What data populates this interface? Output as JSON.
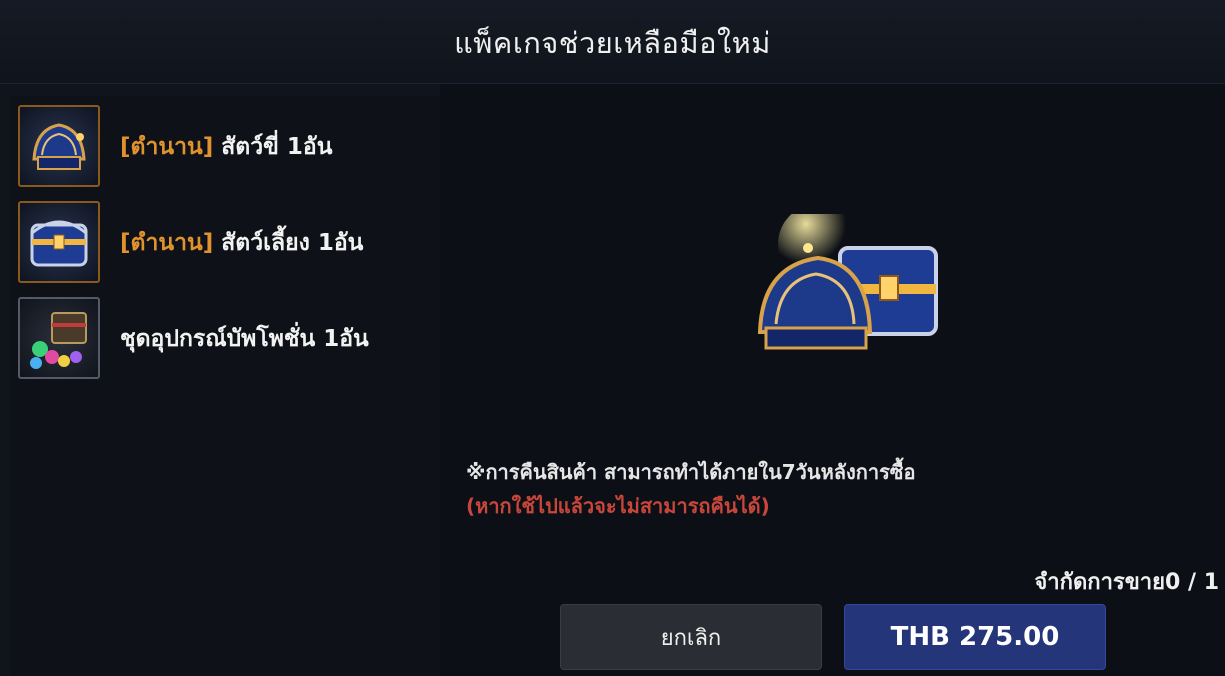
{
  "modal": {
    "title": "แพ็คเกจช่วยเหลือมือใหม่"
  },
  "items": [
    {
      "tag": "[ตำนาน]",
      "name": " สัตว์ขี่ 1อัน",
      "icon": "saddle-chest-icon"
    },
    {
      "tag": "[ตำนาน]",
      "name": " สัตว์เลี้ยง 1อัน",
      "icon": "pet-chest-icon"
    },
    {
      "tag": "",
      "name": "ชุดอุปกรณ์บัพโพชั่น 1อัน",
      "icon": "potion-chest-icon"
    }
  ],
  "detail": {
    "notice": "※การคืนสินค้า สามารถทำได้ภายใน7วันหลังการซื้อ",
    "notice_warn": "(หากใช้ไปแล้วจะไม่สามารถคืนได้)",
    "limit": "จำกัดการขาย0 / 1"
  },
  "buttons": {
    "cancel": "ยกเลิก",
    "buy": "THB 275.00"
  },
  "colors": {
    "tag_orange": "#e0922e",
    "warning_red": "#c9463b",
    "buy_blue": "#24357a"
  }
}
